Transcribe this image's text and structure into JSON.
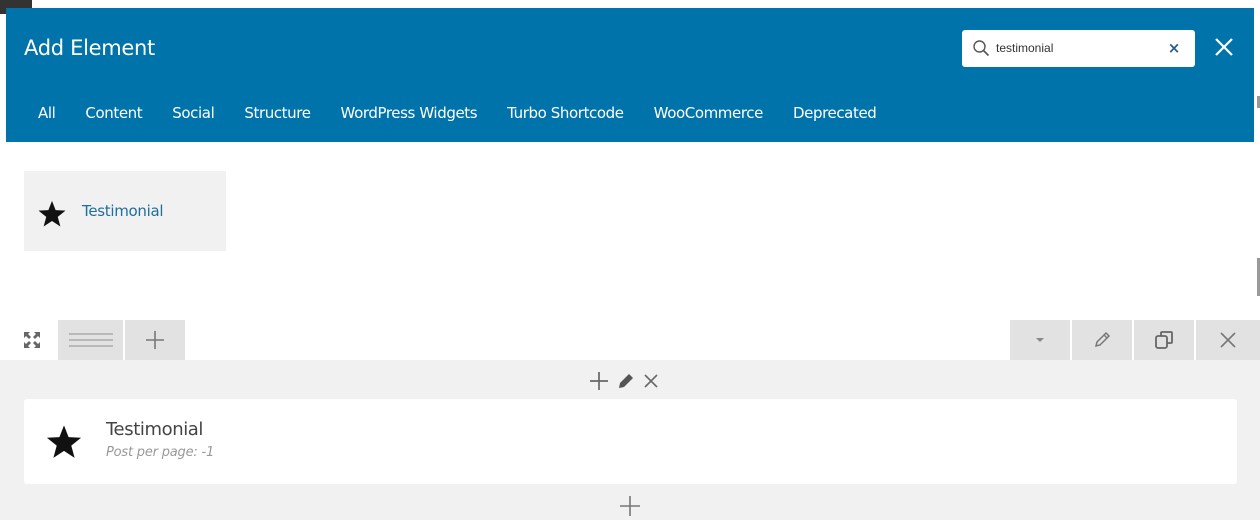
{
  "modal": {
    "title": "Add Element",
    "search": {
      "value": "testimonial",
      "clear_label": "×"
    },
    "close_icon": "close-icon",
    "tabs": [
      {
        "label": "All"
      },
      {
        "label": "Content"
      },
      {
        "label": "Social"
      },
      {
        "label": "Structure"
      },
      {
        "label": "WordPress Widgets"
      },
      {
        "label": "Turbo Shortcode"
      },
      {
        "label": "WooCommerce"
      },
      {
        "label": "Deprecated"
      }
    ]
  },
  "results": [
    {
      "label": "Testimonial",
      "icon": "star-icon"
    }
  ],
  "row_toolbar": {
    "left_icons": [
      "expand-icon",
      "drag-handle-icon",
      "plus-icon"
    ],
    "right_icons": [
      "caret-down-icon",
      "pencil-icon",
      "clone-icon",
      "close-icon"
    ]
  },
  "element": {
    "title": "Testimonial",
    "subtitle": "Post per page: -1",
    "icon": "star-icon"
  },
  "colors": {
    "header_bg": "#0073aa",
    "link": "#1e6e9e",
    "panel_bg": "#f1f1f1",
    "toolbar_bg": "#e2e2e2"
  }
}
